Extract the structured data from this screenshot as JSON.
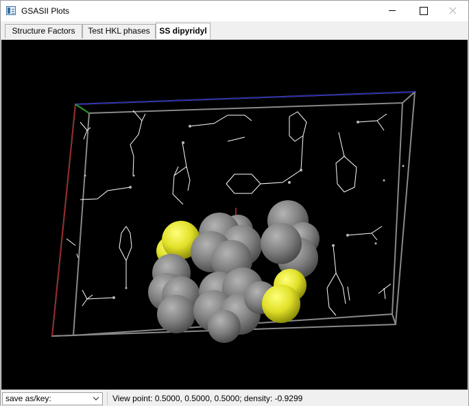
{
  "window": {
    "title": "GSASII Plots"
  },
  "tabs": [
    {
      "label": "Structure Factors",
      "active": false
    },
    {
      "label": "Test HKL phases",
      "active": false
    },
    {
      "label": "SS dipyridyl",
      "active": true
    }
  ],
  "plot": {
    "background": "#000000",
    "atom_color_carbon": "#7a7a7a",
    "atom_color_sulfur": "#e6e62e",
    "axis_colors": {
      "a": "#a01818",
      "b": "#10a010",
      "c": "#2020c0"
    },
    "cell_edge_color": "#8a8a8a",
    "bond_color": "#ffffff"
  },
  "statusbar": {
    "save_as_label": "save as/key:",
    "status_text": "View point: 0.5000, 0.5000, 0.5000; density: -0.9299"
  }
}
